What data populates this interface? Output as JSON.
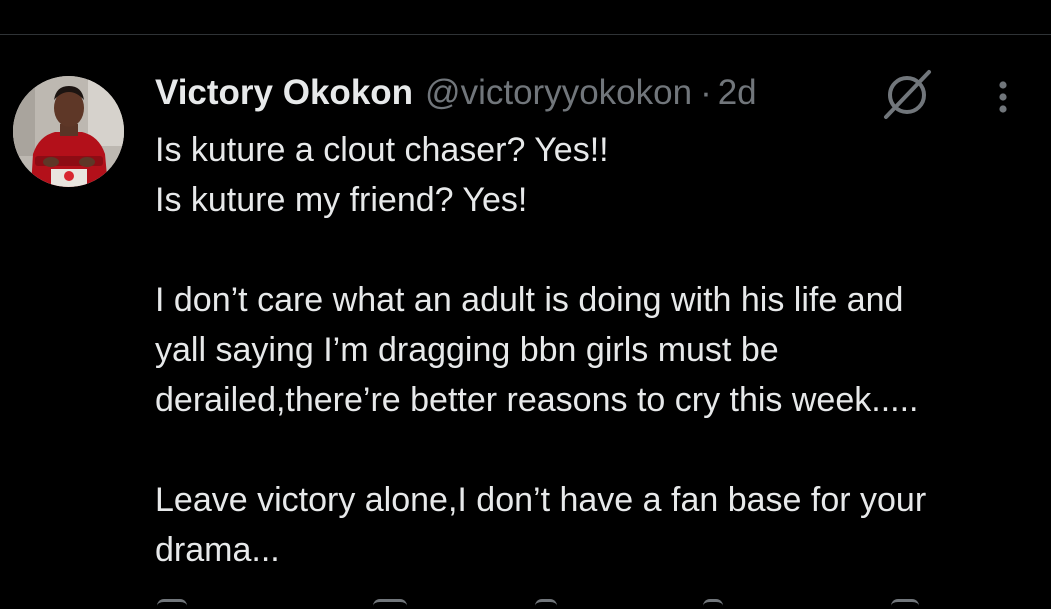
{
  "tweet": {
    "author": {
      "display_name": "Victory Okokon",
      "handle": "@victoryyokokon",
      "separator": "·",
      "time": "2d"
    },
    "lines": [
      "Is kuture a clout chaser? Yes!!",
      "Is kuture my friend? Yes!",
      "",
      "I don’t care what an adult is doing with his life and",
      "yall saying I’m dragging bbn girls must be",
      "derailed,there’re better reasons to cry this week.....",
      "",
      "Leave victory alone,I don’t have a fan base for your",
      "drama..."
    ]
  },
  "icons": {
    "grok": "grok-icon",
    "more": "more-options-icon",
    "actions": [
      "reply-icon",
      "repost-icon",
      "like-icon",
      "views-icon",
      "bookmark-icon"
    ]
  },
  "colors": {
    "background": "#000000",
    "primary_text": "#e7e9ea",
    "secondary_text": "#71767b",
    "divider": "#2f3336"
  }
}
